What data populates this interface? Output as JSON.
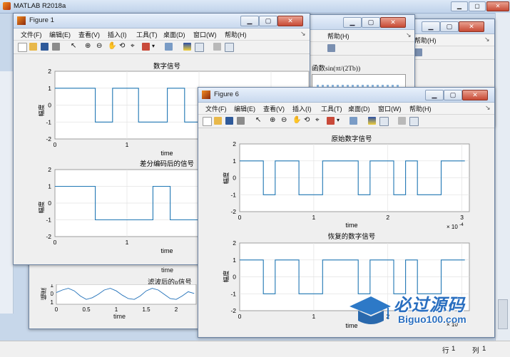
{
  "matlab": {
    "title": "MATLAB R2018a",
    "status_row_label": "行",
    "status_row_value": "1",
    "status_col_label": "列",
    "status_col_value": "1"
  },
  "menus": [
    "文件(F)",
    "编辑(E)",
    "查看(V)",
    "插入(I)",
    "工具(T)",
    "桌面(D)",
    "窗口(W)",
    "帮助(H)"
  ],
  "back_windows": {
    "help_label_1": "帮助(H)",
    "help_label_2": "帮助(H)",
    "plot_title_fragment": "函数sin(πt/(2Tb))",
    "filtered_title": "滤波后的p信号",
    "filtered_ylabel": "幅度",
    "filtered_xlabel": "time",
    "time_fragment": "time",
    "filtered_ticks": [
      "0",
      "0.5",
      "1",
      "1.5",
      "2"
    ],
    "filtered_yticks": [
      "1",
      "0",
      "-1"
    ]
  },
  "figure1": {
    "title": "Figure 1",
    "plot1": {
      "title": "数字信号",
      "ylabel": "幅度",
      "xlabel": "time",
      "yticks": [
        "2",
        "1",
        "0",
        "-1",
        "-2"
      ],
      "xticks": [
        "0",
        "1"
      ]
    },
    "plot2": {
      "title": "差分编码后的信号",
      "ylabel": "幅度",
      "xlabel": "time",
      "yticks": [
        "2",
        "1",
        "0",
        "-1",
        "-2"
      ],
      "xticks": [
        "0",
        "1"
      ]
    }
  },
  "figure6": {
    "title": "Figure 6",
    "plot1": {
      "title": "原始数字信号",
      "ylabel": "幅度",
      "xlabel": "time",
      "yticks": [
        "2",
        "1",
        "0",
        "-1",
        "-2"
      ],
      "xticks": [
        "0",
        "1",
        "2",
        "3"
      ],
      "exponent": "× 10",
      "exponent_power": "-4"
    },
    "plot2": {
      "title": "恢复的数字信号",
      "ylabel": "幅度",
      "xlabel": "time",
      "yticks": [
        "2",
        "1",
        "0",
        "-1",
        "-2"
      ],
      "xticks": [
        "0",
        "1",
        "2"
      ],
      "exponent": "× 10"
    }
  },
  "watermark": {
    "brand": "必过源码",
    "site": "Biguo100.com"
  },
  "chart_data": [
    {
      "type": "line",
      "title": "数字信号",
      "xlabel": "time",
      "ylabel": "幅度",
      "ylim": [
        -2,
        2
      ],
      "grid": true,
      "x": [
        0,
        0.56,
        0.56,
        0.8,
        0.8,
        1.16,
        1.16,
        1.56,
        1.56,
        1.8,
        1.8,
        2.16,
        2.16,
        2.4
      ],
      "y": [
        1,
        1,
        -1,
        -1,
        1,
        1,
        -1,
        -1,
        1,
        1,
        -1,
        -1,
        1,
        1
      ]
    },
    {
      "type": "line",
      "title": "差分编码后的信号",
      "xlabel": "time",
      "ylabel": "幅度",
      "ylim": [
        -2,
        2
      ],
      "grid": true,
      "x": [
        0,
        0.56,
        0.56,
        1.36,
        1.36,
        1.6,
        1.6,
        2.16,
        2.16,
        2.4
      ],
      "y": [
        1,
        1,
        -1,
        -1,
        1,
        1,
        -1,
        -1,
        1,
        1
      ]
    },
    {
      "type": "line",
      "title": "原始数字信号",
      "xlabel": "time",
      "ylabel": "幅度",
      "ylim": [
        -2,
        2
      ],
      "xlim": [
        0,
        3.1
      ],
      "grid": true,
      "x_exponent": "× 10^-4",
      "x": [
        0,
        0.32,
        0.32,
        0.48,
        0.48,
        0.8,
        0.8,
        1.12,
        1.12,
        1.6,
        1.6,
        1.76,
        1.76,
        2.08,
        2.08,
        2.24,
        2.24,
        2.4,
        2.4,
        2.72,
        2.72,
        3.04
      ],
      "y": [
        1,
        1,
        -1,
        -1,
        1,
        1,
        -1,
        -1,
        1,
        1,
        -1,
        -1,
        1,
        1,
        -1,
        -1,
        1,
        1,
        -1,
        -1,
        1,
        1
      ]
    },
    {
      "type": "line",
      "title": "恢复的数字信号",
      "xlabel": "time",
      "ylabel": "幅度",
      "ylim": [
        -2,
        2
      ],
      "xlim": [
        0,
        3.1
      ],
      "grid": true,
      "x": [
        0,
        0.32,
        0.32,
        0.48,
        0.48,
        0.8,
        0.8,
        1.12,
        1.12,
        1.6,
        1.6,
        1.76,
        1.76,
        2.08,
        2.08,
        2.24,
        2.24,
        2.4,
        2.4,
        2.72,
        2.72,
        3.04
      ],
      "y": [
        1,
        1,
        -1,
        -1,
        1,
        1,
        -1,
        -1,
        1,
        1,
        -1,
        -1,
        1,
        1,
        -1,
        -1,
        1,
        1,
        -1,
        -1,
        1,
        1
      ]
    },
    {
      "type": "line",
      "title": "滤波后的p信号",
      "xlabel": "time",
      "ylabel": "幅度",
      "grid": true,
      "x": [
        0,
        0.1,
        0.2,
        0.3,
        0.4,
        0.5,
        0.6,
        0.7,
        0.8,
        0.9,
        1.0,
        1.1,
        1.2,
        1.3,
        1.4,
        1.5,
        1.6,
        1.7,
        1.8,
        1.9,
        2.0,
        2.1,
        2.2,
        2.3
      ],
      "y": [
        0.2,
        0.5,
        0.7,
        0.4,
        -0.2,
        -0.6,
        -0.4,
        0.0,
        0.5,
        0.7,
        0.4,
        -0.1,
        -0.5,
        -0.6,
        -0.2,
        0.4,
        0.7,
        0.5,
        0.0,
        -0.5,
        -0.6,
        -0.2,
        0.3,
        0.1
      ]
    }
  ]
}
